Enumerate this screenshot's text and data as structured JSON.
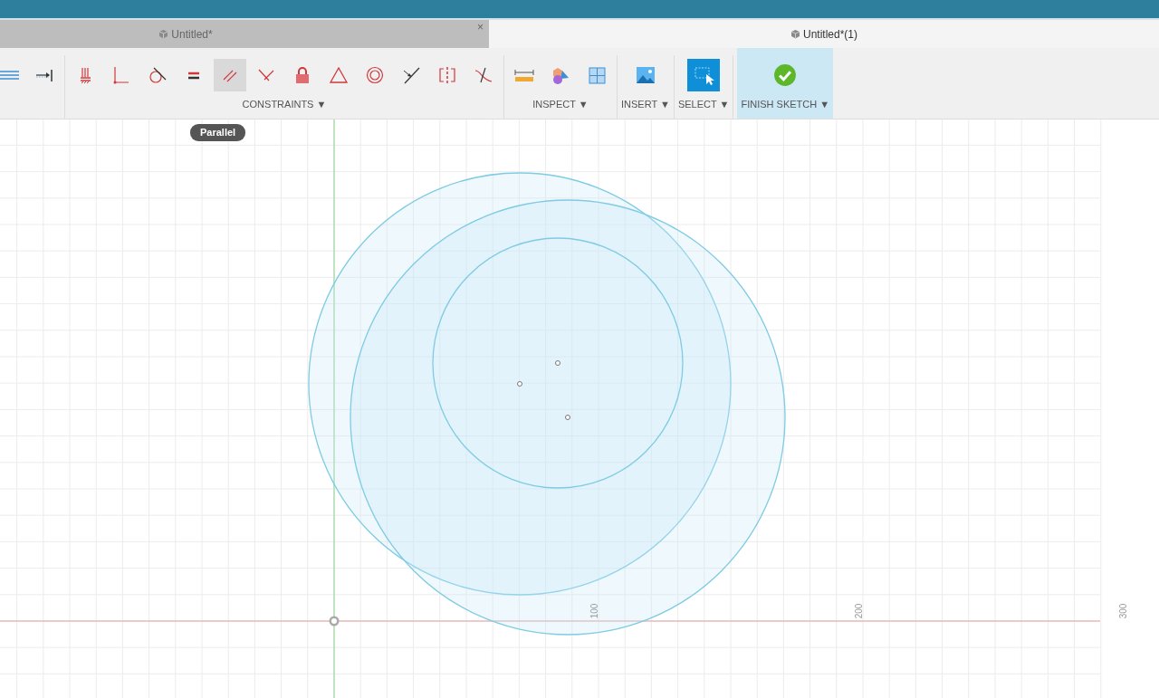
{
  "tabs": [
    {
      "label": "Untitled*",
      "selected": false,
      "close": "×"
    },
    {
      "label": "Untitled*(1)",
      "selected": true
    }
  ],
  "toolbar": {
    "groups": [
      {
        "tools": [
          {
            "kind": "list",
            "selected": false
          },
          {
            "kind": "arrow-bar",
            "selected": false
          }
        ]
      },
      {
        "label": "CONSTRAINTS",
        "caret": "▼",
        "tools": [
          {
            "kind": "fix",
            "selected": false
          },
          {
            "kind": "coincident",
            "selected": false
          },
          {
            "kind": "tangent",
            "selected": false
          },
          {
            "kind": "equal",
            "selected": false
          },
          {
            "kind": "parallel",
            "selected": true
          },
          {
            "kind": "perpendicular",
            "selected": false
          },
          {
            "kind": "lock",
            "selected": false
          },
          {
            "kind": "triangle",
            "selected": false
          },
          {
            "kind": "concentric",
            "selected": false
          },
          {
            "kind": "midpoint",
            "selected": false
          },
          {
            "kind": "symmetry",
            "selected": false
          },
          {
            "kind": "curvature",
            "selected": false
          }
        ]
      },
      {
        "label": "INSPECT",
        "caret": "▼",
        "tools": [
          {
            "kind": "measure",
            "selected": false
          },
          {
            "kind": "shapes",
            "selected": false
          },
          {
            "kind": "frame",
            "selected": false
          }
        ]
      },
      {
        "label": "INSERT",
        "caret": "▼",
        "tools": [
          {
            "kind": "image",
            "selected": false
          }
        ]
      },
      {
        "label": "SELECT",
        "caret": "▼",
        "tools": [
          {
            "kind": "select",
            "selected": false
          }
        ]
      },
      {
        "label": "FINISH SKETCH",
        "caret": "▼",
        "highlighted": true,
        "tools": [
          {
            "kind": "finish",
            "selected": false
          }
        ]
      }
    ]
  },
  "tooltip": "Parallel",
  "axis_labels": [
    "100",
    "200",
    "300"
  ]
}
